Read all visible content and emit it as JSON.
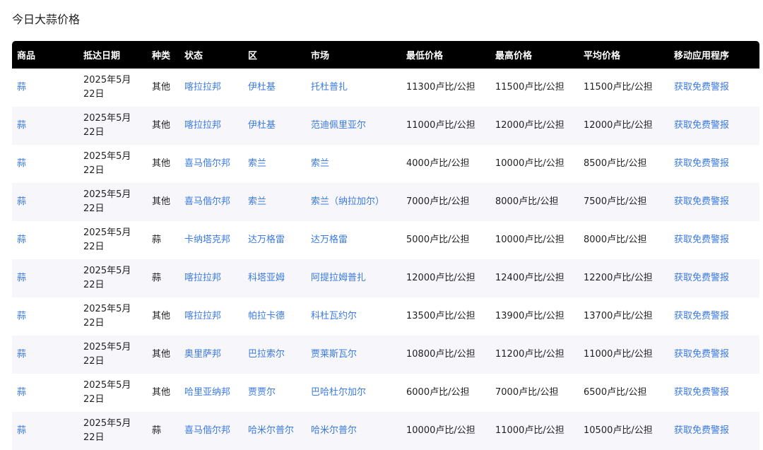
{
  "page": {
    "title": "今日大蒜价格"
  },
  "table": {
    "headers": [
      "商品",
      "抵达日期",
      "种类",
      "状态",
      "区",
      "市场",
      "最低价格",
      "最高价格",
      "平均价格",
      "移动应用程序"
    ],
    "rows": [
      [
        "蒜",
        "2025年5月22日",
        "其他",
        "喀拉拉邦",
        "伊杜基",
        "托杜普扎",
        "11300卢比/公担",
        "11500卢比/公担",
        "11500卢比/公担",
        "获取免费警报"
      ],
      [
        "蒜",
        "2025年5月22日",
        "其他",
        "喀拉拉邦",
        "伊杜基",
        "范迪佩里亚尔",
        "11000卢比/公担",
        "12000卢比/公担",
        "12000卢比/公担",
        "获取免费警报"
      ],
      [
        "蒜",
        "2025年5月22日",
        "其他",
        "喜马偕尔邦",
        "索兰",
        "索兰",
        "4000卢比/公担",
        "10000卢比/公担",
        "8500卢比/公担",
        "获取免费警报"
      ],
      [
        "蒜",
        "2025年5月22日",
        "其他",
        "喜马偕尔邦",
        "索兰",
        "索兰（纳拉加尔）",
        "7000卢比/公担",
        "8000卢比/公担",
        "7500卢比/公担",
        "获取免费警报"
      ],
      [
        "蒜",
        "2025年5月22日",
        "蒜",
        "卡纳塔克邦",
        "达万格雷",
        "达万格雷",
        "5000卢比/公担",
        "10000卢比/公担",
        "8000卢比/公担",
        "获取免费警报"
      ],
      [
        "蒜",
        "2025年5月22日",
        "蒜",
        "喀拉拉邦",
        "科塔亚姆",
        "阿提拉姆普扎",
        "12000卢比/公担",
        "12400卢比/公担",
        "12200卢比/公担",
        "获取免费警报"
      ],
      [
        "蒜",
        "2025年5月22日",
        "其他",
        "喀拉拉邦",
        "帕拉卡德",
        "科杜瓦约尔",
        "13500卢比/公担",
        "13900卢比/公担",
        "13700卢比/公担",
        "获取免费警报"
      ],
      [
        "蒜",
        "2025年5月22日",
        "其他",
        "奥里萨邦",
        "巴拉索尔",
        "贾莱斯瓦尔",
        "10800卢比/公担",
        "11200卢比/公担",
        "11000卢比/公担",
        "获取免费警报"
      ],
      [
        "蒜",
        "2025年5月22日",
        "其他",
        "哈里亚纳邦",
        "贾贾尔",
        "巴哈杜尔加尔",
        "6000卢比/公担",
        "7000卢比/公担",
        "6500卢比/公担",
        "获取免费警报"
      ],
      [
        "蒜",
        "2025年5月22日",
        "蒜",
        "喜马偕尔邦",
        "哈米尔普尔",
        "哈米尔普尔",
        "10000卢比/公担",
        "11000卢比/公担",
        "10500卢比/公担",
        "获取免费警报"
      ]
    ]
  },
  "colors": {
    "link": "#3b7ae0",
    "header_bg": "#000000",
    "stripe": "#f6f6fb"
  }
}
